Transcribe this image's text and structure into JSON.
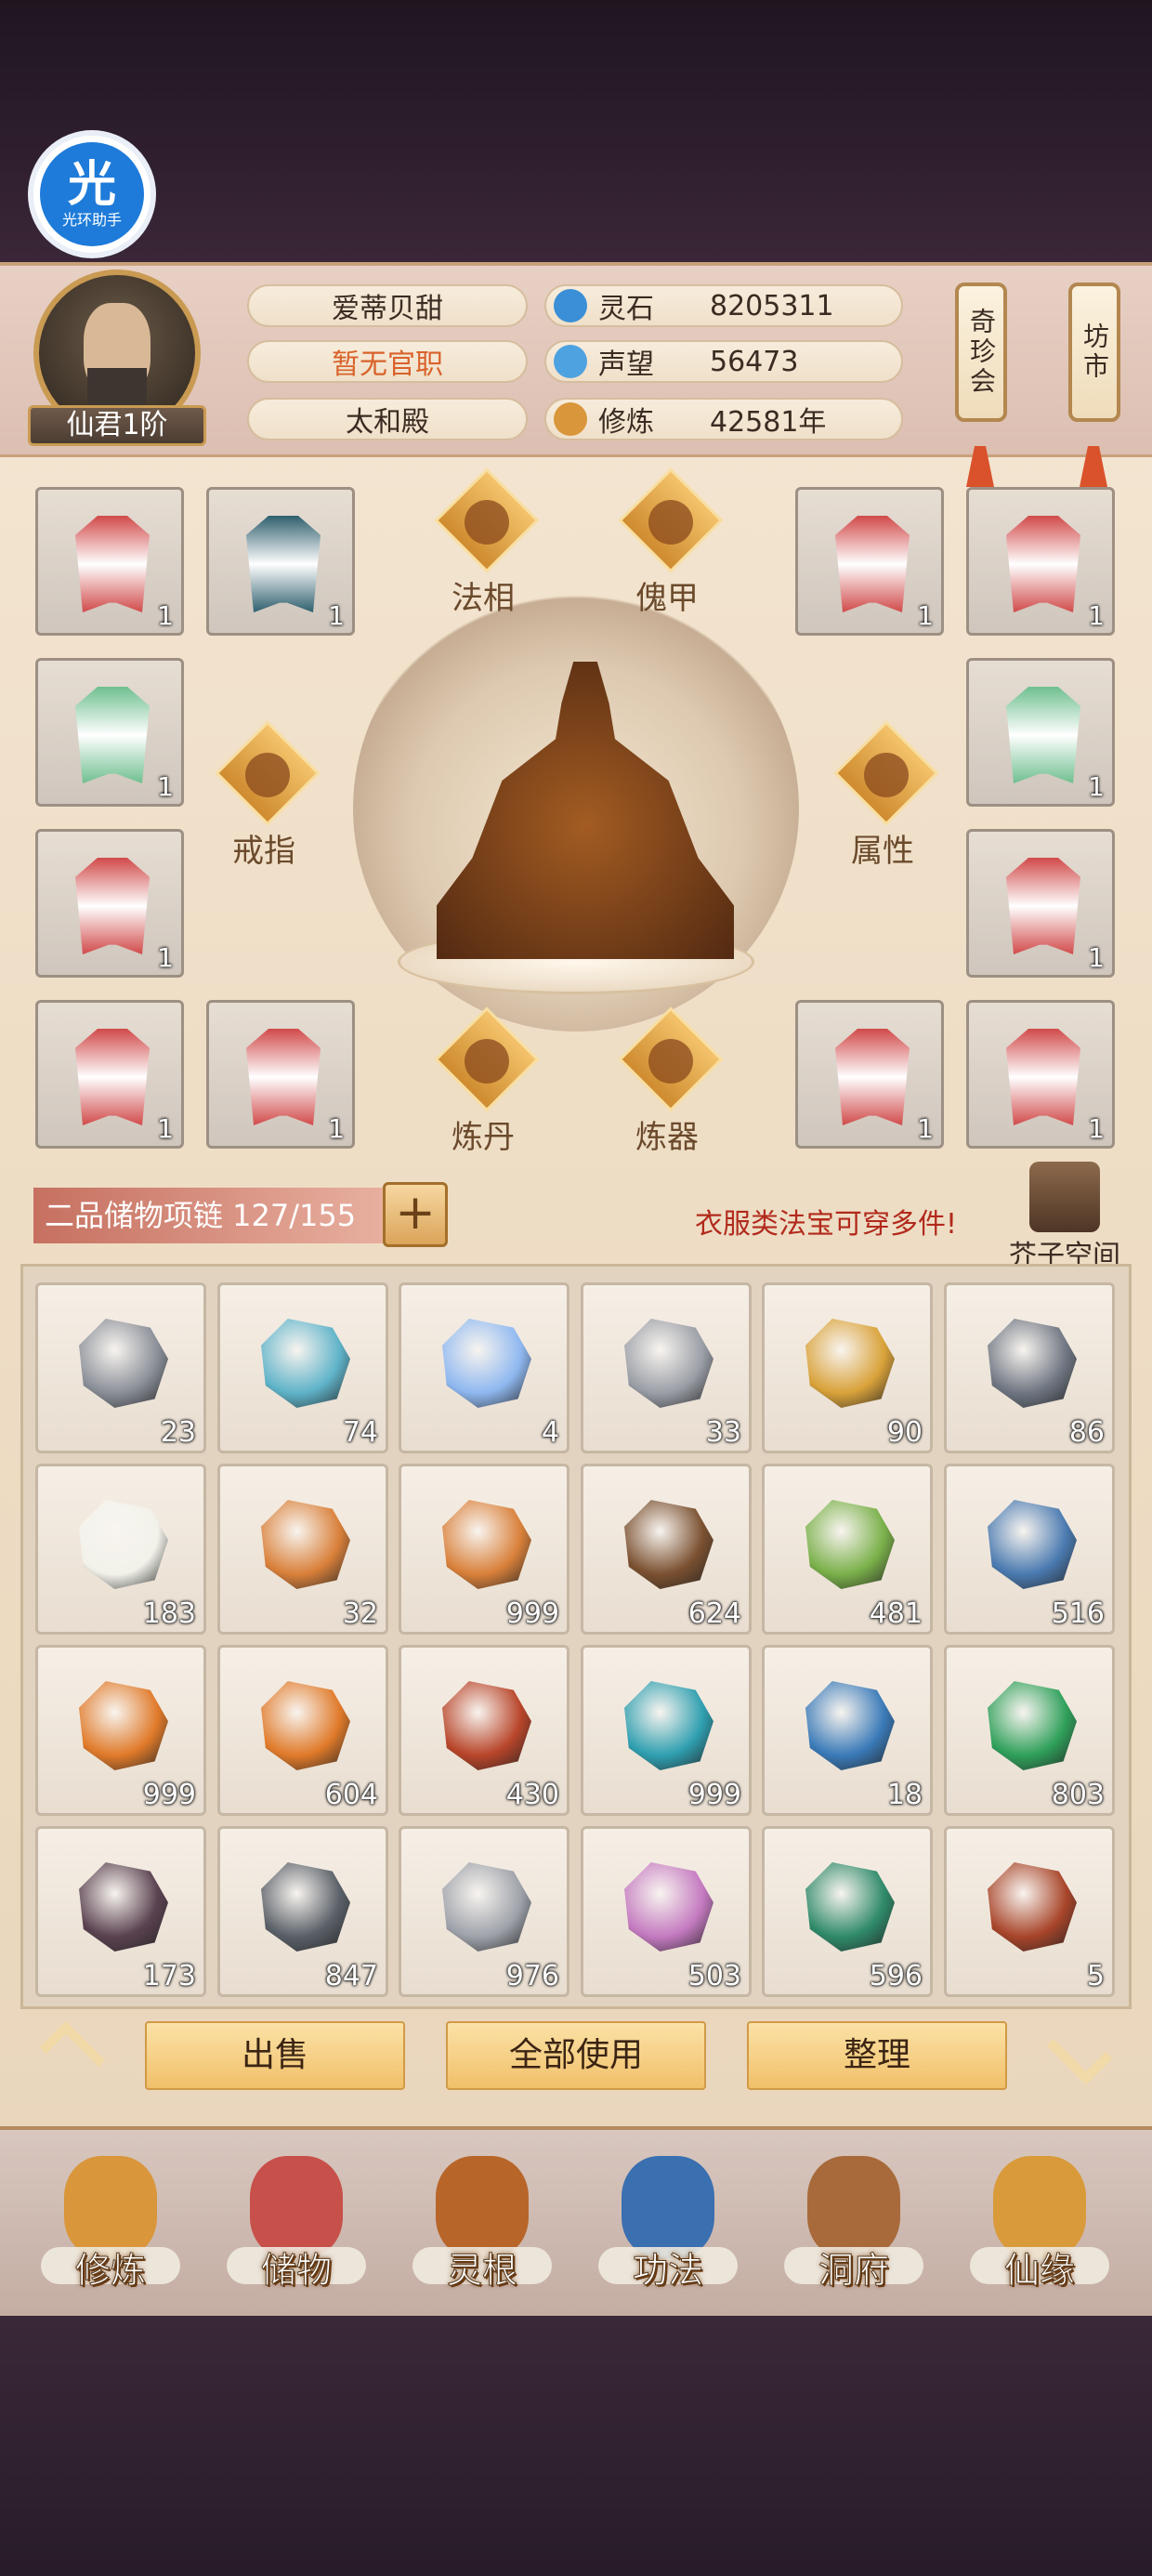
{
  "overlay": {
    "badge_big": "光",
    "badge_small": "光环助手"
  },
  "player": {
    "rank": "仙君1阶",
    "name": "爱蒂贝甜",
    "office": "暂无官职",
    "sect": "太和殿"
  },
  "stats": [
    {
      "label": "灵石",
      "value": "8205311",
      "icon": "spirit-stone-icon",
      "color": "#3a8fd6"
    },
    {
      "label": "声望",
      "value": "56473",
      "icon": "prestige-icon",
      "color": "#4ea2e0"
    },
    {
      "label": "修炼",
      "value": "42581年",
      "icon": "cultivation-icon",
      "color": "#d9963a"
    }
  ],
  "side_tabs": {
    "treasure_fair": "奇珍会",
    "market": "坊市"
  },
  "equip_nodes": {
    "fa_xiang": "法相",
    "kui_jia": "傀甲",
    "ring": "戒指",
    "attributes": "属性",
    "alchemy": "炼丹",
    "forging": "炼器"
  },
  "equip_slots": [
    {
      "qty": "1",
      "color": "#d14a4a"
    },
    {
      "qty": "1",
      "color": "#2f5f6e"
    },
    {
      "qty": "1",
      "color": "#d14a4a"
    },
    {
      "qty": "1",
      "color": "#d14a4a"
    },
    {
      "qty": "1",
      "color": "#6fbf8f"
    },
    {
      "qty": "1",
      "color": "#6fbf8f"
    },
    {
      "qty": "1",
      "color": "#d14a4a"
    },
    {
      "qty": "1",
      "color": "#d14a4a"
    },
    {
      "qty": "1",
      "color": "#d14a4a"
    },
    {
      "qty": "1",
      "color": "#d14a4a"
    },
    {
      "qty": "1",
      "color": "#d14a4a"
    },
    {
      "qty": "1",
      "color": "#d14a4a"
    }
  ],
  "storage": {
    "bag_label": "二品储物项链 127/155",
    "hint": "衣服类法宝可穿多件!",
    "space_label": "芥子空间"
  },
  "inventory": [
    {
      "qty": "23",
      "color": "#8a8f98"
    },
    {
      "qty": "74",
      "color": "#5fb3c9"
    },
    {
      "qty": "4",
      "color": "#8fb8f0"
    },
    {
      "qty": "33",
      "color": "#9a9ea6"
    },
    {
      "qty": "90",
      "color": "#d9a23a"
    },
    {
      "qty": "86",
      "color": "#6f7682"
    },
    {
      "qty": "183",
      "color": "#f2f2ea"
    },
    {
      "qty": "32",
      "color": "#d9803a"
    },
    {
      "qty": "999",
      "color": "#d9803a"
    },
    {
      "qty": "624",
      "color": "#7a5030"
    },
    {
      "qty": "481",
      "color": "#7ab04a"
    },
    {
      "qty": "516",
      "color": "#4a7ab0"
    },
    {
      "qty": "999",
      "color": "#e07a2a"
    },
    {
      "qty": "604",
      "color": "#e07a2a"
    },
    {
      "qty": "430",
      "color": "#b8452a"
    },
    {
      "qty": "999",
      "color": "#2f9fb0"
    },
    {
      "qty": "18",
      "color": "#3a7ab8"
    },
    {
      "qty": "803",
      "color": "#2fa05a"
    },
    {
      "qty": "173",
      "color": "#5a4250"
    },
    {
      "qty": "847",
      "color": "#5a6068"
    },
    {
      "qty": "976",
      "color": "#9ea2aa"
    },
    {
      "qty": "503",
      "color": "#c47ac0"
    },
    {
      "qty": "596",
      "color": "#2f8a6a"
    },
    {
      "qty": "5",
      "color": "#a8452a"
    }
  ],
  "actions": {
    "sell": "出售",
    "use_all": "全部使用",
    "sort": "整理"
  },
  "nav": [
    {
      "label": "修炼",
      "color": "#d9963a"
    },
    {
      "label": "储物",
      "color": "#c8504a"
    },
    {
      "label": "灵根",
      "color": "#b8652a"
    },
    {
      "label": "功法",
      "color": "#3a6fb0"
    },
    {
      "label": "洞府",
      "color": "#a86a3a"
    },
    {
      "label": "仙缘",
      "color": "#d99a3a"
    }
  ]
}
